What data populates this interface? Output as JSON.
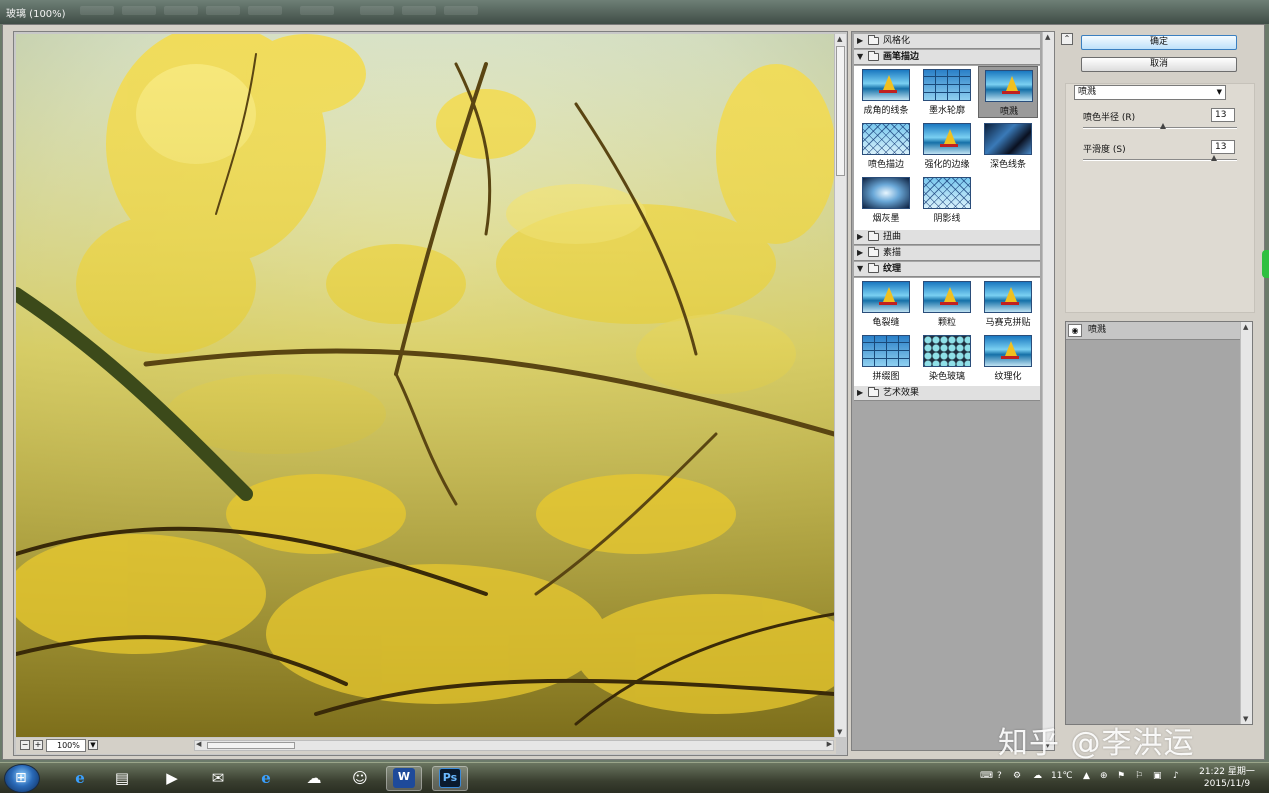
{
  "window": {
    "title": "玻璃 (100%)"
  },
  "preview": {
    "zoom_level": "100%"
  },
  "gallery": {
    "categories": [
      {
        "label": "风格化",
        "expanded": false
      },
      {
        "label": "画笔描边",
        "expanded": true,
        "items": [
          {
            "label": "成角的线条",
            "thumb": "sail"
          },
          {
            "label": "墨水轮廓",
            "thumb": "mosaic"
          },
          {
            "label": "喷溅",
            "thumb": "sail",
            "selected": true
          },
          {
            "label": "喷色描边",
            "thumb": "cross"
          },
          {
            "label": "强化的边缘",
            "thumb": "sail"
          },
          {
            "label": "深色线条",
            "thumb": "dark"
          },
          {
            "label": "烟灰墨",
            "thumb": "smudge"
          },
          {
            "label": "阴影线",
            "thumb": "cross"
          }
        ]
      },
      {
        "label": "扭曲",
        "expanded": false
      },
      {
        "label": "素描",
        "expanded": false
      },
      {
        "label": "纹理",
        "expanded": true,
        "items": [
          {
            "label": "龟裂缝",
            "thumb": "sail"
          },
          {
            "label": "颗粒",
            "thumb": "sail"
          },
          {
            "label": "马赛克拼贴",
            "thumb": "sail"
          },
          {
            "label": "拼缀图",
            "thumb": "mosaic"
          },
          {
            "label": "染色玻璃",
            "thumb": "glass"
          },
          {
            "label": "纹理化",
            "thumb": "sail"
          }
        ]
      },
      {
        "label": "艺术效果",
        "expanded": false
      }
    ]
  },
  "controls": {
    "ok_label": "确定",
    "cancel_label": "取消",
    "filter_select": "喷溅",
    "params": [
      {
        "label": "喷色半径 (R)",
        "value": "13",
        "fraction": 0.52
      },
      {
        "label": "平滑度 (S)",
        "value": "13",
        "fraction": 0.85
      }
    ]
  },
  "layers": {
    "items": [
      {
        "label": "喷溅"
      }
    ]
  },
  "watermark": "知乎 @李洪运",
  "taskbar": {
    "weather": "11℃",
    "time": "21:22 星期一",
    "date": "2015/11/9"
  },
  "colors": {
    "accent": "#3a7fc0",
    "panel_bg": "#d4d0c8",
    "gallery_bg": "#a6a6a6"
  }
}
